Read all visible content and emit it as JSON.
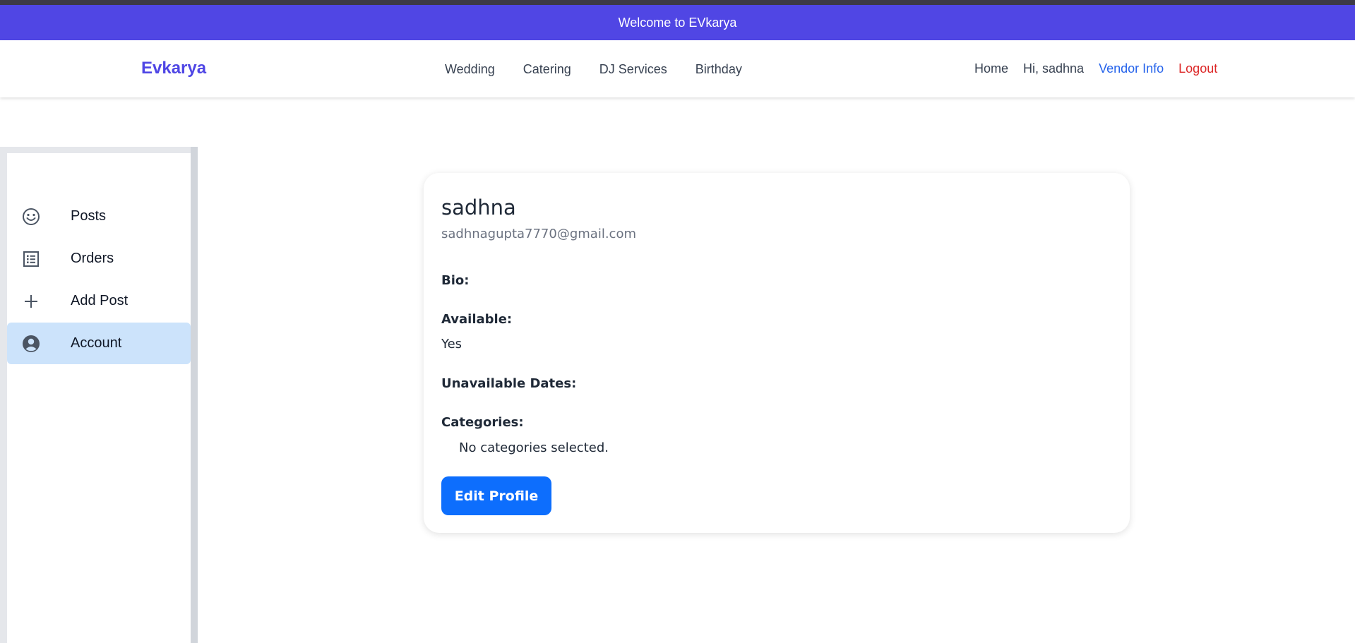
{
  "banner": {
    "text": "Welcome to EVkarya"
  },
  "navbar": {
    "brand": "Evkarya",
    "categories": [
      "Wedding",
      "Catering",
      "DJ Services",
      "Birthday"
    ],
    "home": "Home",
    "greeting": "Hi, sadhna",
    "vendor_info": "Vendor Info",
    "logout": "Logout"
  },
  "sidebar": {
    "items": [
      {
        "label": "Posts",
        "icon": "smiley-icon"
      },
      {
        "label": "Orders",
        "icon": "list-icon"
      },
      {
        "label": "Add Post",
        "icon": "plus-icon"
      },
      {
        "label": "Account",
        "icon": "account-circle-icon",
        "active": true
      }
    ]
  },
  "profile": {
    "name": "sadhna",
    "email": "sadhnagupta7770@gmail.com",
    "bio_label": "Bio:",
    "available_label": "Available:",
    "available_value": "Yes",
    "unavailable_label": "Unavailable Dates:",
    "categories_label": "Categories:",
    "categories_value": "No categories selected.",
    "edit_button": "Edit Profile"
  },
  "colors": {
    "banner": "#5046e4",
    "brand": "#4f46e5",
    "vendor_link": "#2563eb",
    "logout_link": "#dc2626",
    "active_sidebar": "#cce3fb",
    "button": "#0d6efd"
  }
}
